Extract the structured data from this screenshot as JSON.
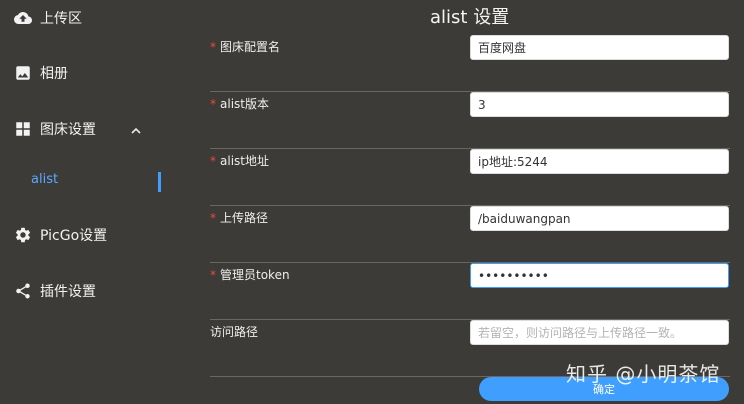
{
  "sidebar": {
    "items": [
      {
        "label": "上传区",
        "icon": "cloud-upload-icon"
      },
      {
        "label": "相册",
        "icon": "image-icon"
      },
      {
        "label": "图床设置",
        "icon": "grid-icon",
        "expanded": true
      },
      {
        "label": "PicGo设置",
        "icon": "gear-icon"
      },
      {
        "label": "插件设置",
        "icon": "share-icon"
      }
    ],
    "sub_item": {
      "label": "alist",
      "active": true
    }
  },
  "main": {
    "title": "alist 设置",
    "fields": [
      {
        "label": "图床配置名",
        "required": true,
        "value": "百度网盘",
        "placeholder": ""
      },
      {
        "label": "alist版本",
        "required": true,
        "value": "3",
        "placeholder": ""
      },
      {
        "label": "alist地址",
        "required": true,
        "value": "ip地址:5244",
        "placeholder": ""
      },
      {
        "label": "上传路径",
        "required": true,
        "value": "/baiduwangpan",
        "placeholder": ""
      },
      {
        "label": "管理员token",
        "required": true,
        "value": "••••••••••",
        "placeholder": "",
        "type": "password"
      },
      {
        "label": "访问路径",
        "required": false,
        "value": "",
        "placeholder": "若留空，则访问路径与上传路径一致。"
      }
    ],
    "confirm_label": "确定"
  },
  "watermark": "知乎 @小明茶馆",
  "colors": {
    "accent": "#409eff",
    "background": "#3d3b37",
    "required": "#e74c3c"
  }
}
